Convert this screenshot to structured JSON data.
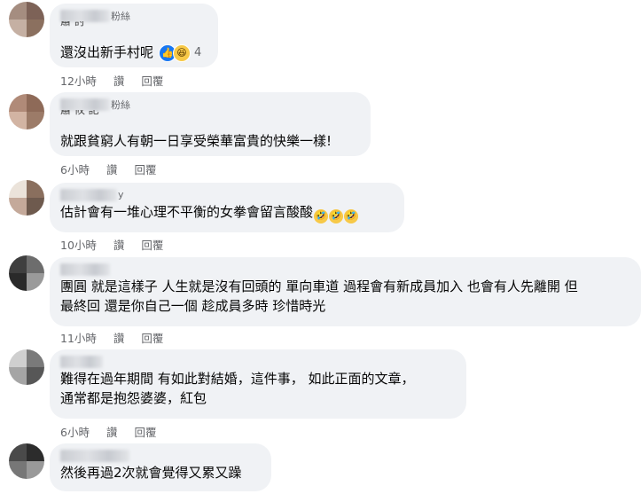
{
  "comments": [
    {
      "name_suffix": "粉絲",
      "cut_text": "肅 討",
      "text": "還沒出新手村呢",
      "reaction_count": "4",
      "time": "12小時",
      "like": "讚",
      "reply": "回覆",
      "avatar_colors": [
        "#a58d80",
        "#7d6257",
        "#c5b0a3",
        "#8b705f"
      ]
    },
    {
      "name_suffix": "粉絲",
      "cut_text": "肅 攸 記",
      "text": "就跟貧窮人有朝一日享受榮華富貴的快樂一樣!",
      "time": "6小時",
      "like": "讚",
      "reply": "回覆",
      "avatar_colors": [
        "#b08a78",
        "#8e6a58",
        "#d2b4a3",
        "#9c7b68"
      ]
    },
    {
      "name_suffix": "y",
      "text": "估計會有一堆心理不平衡的女拳會留言酸酸",
      "time": "10小時",
      "like": "讚",
      "reply": "回覆",
      "avatar_colors": [
        "#ebe3da",
        "#8a6f5e",
        "#c4a99a",
        "#6e5a4e"
      ]
    },
    {
      "text_lines": [
        "團圓 就是這樣子 人生就是沒有回頭的 單向車道 過程會有新成員加入 也會有人先離開 但",
        "最終回 還是你自己一個 趁成員多時 珍惜時光"
      ],
      "time": "11小時",
      "like": "讚",
      "reply": "回覆",
      "avatar_colors": [
        "#3f3f3f",
        "#6d6d6d",
        "#2a2a2a",
        "#9a9a9a"
      ]
    },
    {
      "text_lines": [
        "難得在過年期間 有如此對結婚，這件事， 如此正面的文章，",
        "通常都是抱怨婆婆，紅包"
      ],
      "time": "6小時",
      "like": "讚",
      "reply": "回覆",
      "avatar_colors": [
        "#cfcfcf",
        "#7a7a7a",
        "#a5a5a5",
        "#575757"
      ]
    },
    {
      "text": "然後再過2次就會覺得又累又躁",
      "avatar_colors": [
        "#4a4a4a",
        "#2c2c2c",
        "#777777",
        "#999999"
      ]
    }
  ]
}
